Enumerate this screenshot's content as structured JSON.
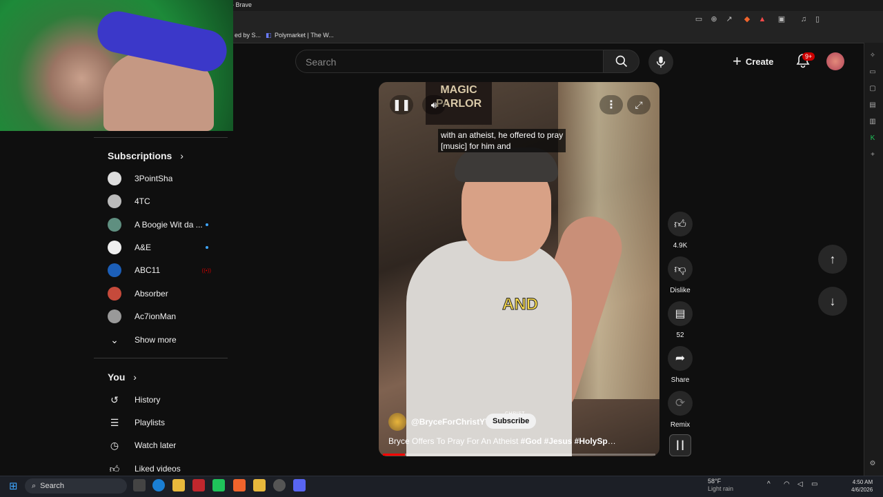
{
  "browser": {
    "title_suffix": "- Brave",
    "bookmarks": [
      "ed by S...",
      "Polymarket | The W..."
    ]
  },
  "header": {
    "search_placeholder": "Search",
    "create_label": "Create",
    "notifications_badge": "9+"
  },
  "sidebar": {
    "subscriptions_title": "Subscriptions",
    "subscriptions": [
      {
        "label": "3PointSha",
        "indicator": "none",
        "color": "#dddddd"
      },
      {
        "label": "4TC",
        "indicator": "none",
        "color": "#bbbbbb"
      },
      {
        "label": "A Boogie Wit da ...",
        "indicator": "dot",
        "color": "#5f8f80"
      },
      {
        "label": "A&E",
        "indicator": "dot",
        "color": "#eeeeee"
      },
      {
        "label": "ABC11",
        "indicator": "live",
        "color": "#1c5fb8"
      },
      {
        "label": "Absorber",
        "indicator": "none",
        "color": "#c64a3b"
      },
      {
        "label": "Ac7ionMan",
        "indicator": "none",
        "color": "#999999"
      }
    ],
    "show_more": "Show more",
    "you_title": "You",
    "you_items": [
      {
        "label": "History",
        "icon": "history-icon"
      },
      {
        "label": "Playlists",
        "icon": "playlists-icon"
      },
      {
        "label": "Watch later",
        "icon": "watch-later-icon"
      },
      {
        "label": "Liked videos",
        "icon": "liked-videos-icon"
      }
    ]
  },
  "video": {
    "sign_text": "MAGIC PARLOR",
    "captions": "with an atheist, he offered to pray\n[music] for him and",
    "overlay_word": "AND",
    "stamp": "CHRIST",
    "channel": "@BryceForChristYT",
    "subscribe_label": "Subscribe",
    "title_plain": "Bryce Offers To Pray For An Atheist ",
    "title_tags": "#God #Jesus #HolySpirit ...",
    "progress": 0.08
  },
  "actions": {
    "like_count": "4.9K",
    "dislike_label": "Dislike",
    "comments_count": "52",
    "share_label": "Share",
    "remix_label": "Remix"
  },
  "taskbar": {
    "search_label": "Search",
    "weather_temp": "58°F",
    "weather_desc": "Light rain",
    "time": "4:50 AM",
    "date": "4/6/2026"
  },
  "colors": {
    "accent_red": "#ff0000",
    "link_blue": "#3ea6ff",
    "bg": "#0f0f0f"
  }
}
